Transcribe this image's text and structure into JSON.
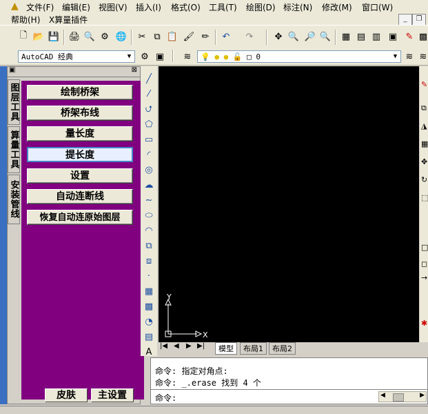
{
  "menubar": {
    "row1": [
      "文件(F)",
      "编辑(E)",
      "视图(V)",
      "插入(I)",
      "格式(O)",
      "工具(T)",
      "绘图(D)",
      "标注(N)",
      "修改(M)",
      "窗口(W)"
    ],
    "row2": [
      "帮助(H)",
      "X算量插件"
    ]
  },
  "toolbar2": {
    "workspace": "AutoCAD 经典",
    "layer_value": "0"
  },
  "panel": {
    "vertical_tabs": [
      "图层工具",
      "算量工具",
      "安装管线"
    ],
    "buttons": [
      "绘制桥架",
      "桥架布线",
      "量长度",
      "提长度",
      "设置",
      "自动连断线",
      "恢复自动连原始图层"
    ],
    "bottom_buttons": [
      "皮肤",
      "主设置"
    ]
  },
  "canvas": {
    "axis_x": "X",
    "axis_y": "Y"
  },
  "layout_tabs": [
    "模型",
    "布局1",
    "布局2"
  ],
  "command": {
    "lines": [
      "命令: 指定对角点:",
      "命令: _.erase 找到 4 个",
      "命令:"
    ]
  },
  "colors": {
    "panel_bg": "#800080",
    "canvas_bg": "#000000"
  }
}
